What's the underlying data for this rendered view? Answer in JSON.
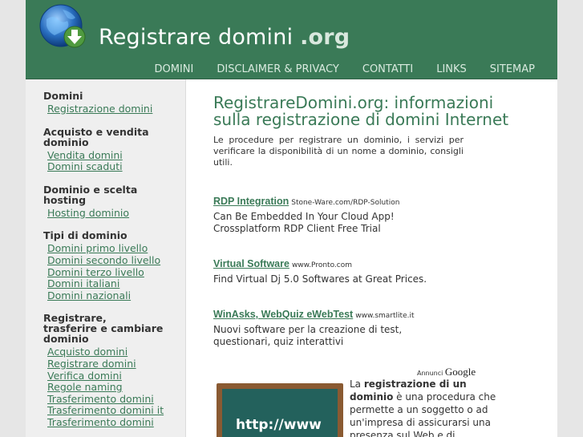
{
  "header": {
    "title": "Registrare domini",
    "title_ext": ".org",
    "logo_icon": "globe-download-icon",
    "nav": [
      "DOMINI",
      "DISCLAIMER & PRIVACY",
      "CONTATTI",
      "LINKS",
      "SITEMAP"
    ]
  },
  "sidebar": {
    "sections": [
      {
        "title": "Domini",
        "links": [
          "Registrazione domini"
        ]
      },
      {
        "title": "Acquisto e vendita dominio",
        "links": [
          "Vendita domini",
          "Domini scaduti"
        ]
      },
      {
        "title": "Dominio e scelta hosting",
        "links": [
          "Hosting dominio"
        ]
      },
      {
        "title": "Tipi di dominio",
        "links": [
          "Domini primo livello",
          "Domini secondo livello",
          "Domini terzo livello",
          "Domini italiani",
          "Domini nazionali"
        ]
      },
      {
        "title": "Registrare, trasferire e cambiare dominio",
        "links": [
          "Acquisto domini",
          "Registrare domini",
          "Verifica domini",
          "Regole naming",
          "Trasferimento domini",
          "Trasferimento domini it",
          "Trasferimento domini"
        ]
      }
    ]
  },
  "main": {
    "title": "RegistrareDomini.org: informazioni sulla registrazione di domini Internet",
    "intro": "Le procedure per registrare un dominio, i servizi per verificare la disponibilità di un nome a dominio, consigli utili.",
    "ads": [
      {
        "title": "RDP Integration",
        "url": "Stone-Ware.com/RDP-Solution",
        "lines": [
          "Can Be Embedded In Your Cloud App!",
          "Crossplatform RDP Client Free Trial"
        ]
      },
      {
        "title": "Virtual Software",
        "url": "www.Pronto.com",
        "lines": [
          "Find Virtual Dj 5.0 Softwares at Great Prices."
        ]
      },
      {
        "title": "WinAsks, WebQuiz eWebTest",
        "url": "www.smartlite.it",
        "lines": [
          "Nuovi software per la creazione di test,",
          "questionari, quiz interattivi"
        ]
      }
    ],
    "ads_by_label": "Annunci",
    "ads_by_brand": "Google",
    "image_text": "http://www",
    "body_pre": "La ",
    "body_bold": "registrazione di un dominio",
    "body_post": " è una procedura che permette a un soggetto o ad un'impresa di assicurarsi una presenza sul Web e di accedere così"
  },
  "colors": {
    "brand_green": "#3a7a57",
    "page_bg": "#e6e6e6",
    "sidebar_bg": "#efefef"
  }
}
